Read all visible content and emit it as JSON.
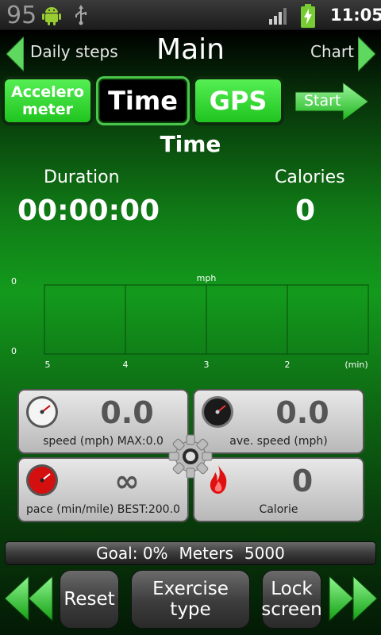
{
  "status_bar": {
    "notification_count": "95",
    "time": "11:05",
    "icons": [
      "android-icon",
      "usb-icon",
      "signal-icon",
      "battery-charging-icon"
    ]
  },
  "nav": {
    "left_label": "Daily steps",
    "title": "Main",
    "right_label": "Chart"
  },
  "modes": {
    "accelerometer_label": "Accelero\nmeter",
    "time_label": "Time",
    "gps_label": "GPS",
    "start_label": "Start",
    "selected": "Time"
  },
  "section_title": "Time",
  "stats": {
    "duration_label": "Duration",
    "duration_value": "00:00:00",
    "calories_label": "Calories",
    "calories_value": "0"
  },
  "chart_data": {
    "type": "line",
    "title": "mph",
    "ylabel_ticks": [
      "0",
      "0"
    ],
    "x_ticks": [
      "5",
      "4",
      "3",
      "2"
    ],
    "x_unit": "(min)",
    "series": [],
    "grid": true
  },
  "panels": [
    {
      "value": "0.0",
      "label": "speed (mph) MAX:0.0",
      "icon": "speedometer-white-icon"
    },
    {
      "value": "0.0",
      "label": "ave. speed (mph)",
      "icon": "speedometer-black-icon"
    },
    {
      "value": "∞",
      "label": "pace (min/mile) BEST:200.0",
      "icon": "speedometer-red-icon"
    },
    {
      "value": "0",
      "label": "Calorie",
      "icon": "flame-icon"
    }
  ],
  "goal": {
    "text": "Goal: 0%",
    "unit": "Meters",
    "target": "5000"
  },
  "bottom": {
    "reset_label": "Reset",
    "exercise_label": "Exercise type",
    "lock_label": "Lock\nscreen"
  },
  "colors": {
    "accent_green": "#2fd62f",
    "panel_gray": "#d0d0d0"
  }
}
